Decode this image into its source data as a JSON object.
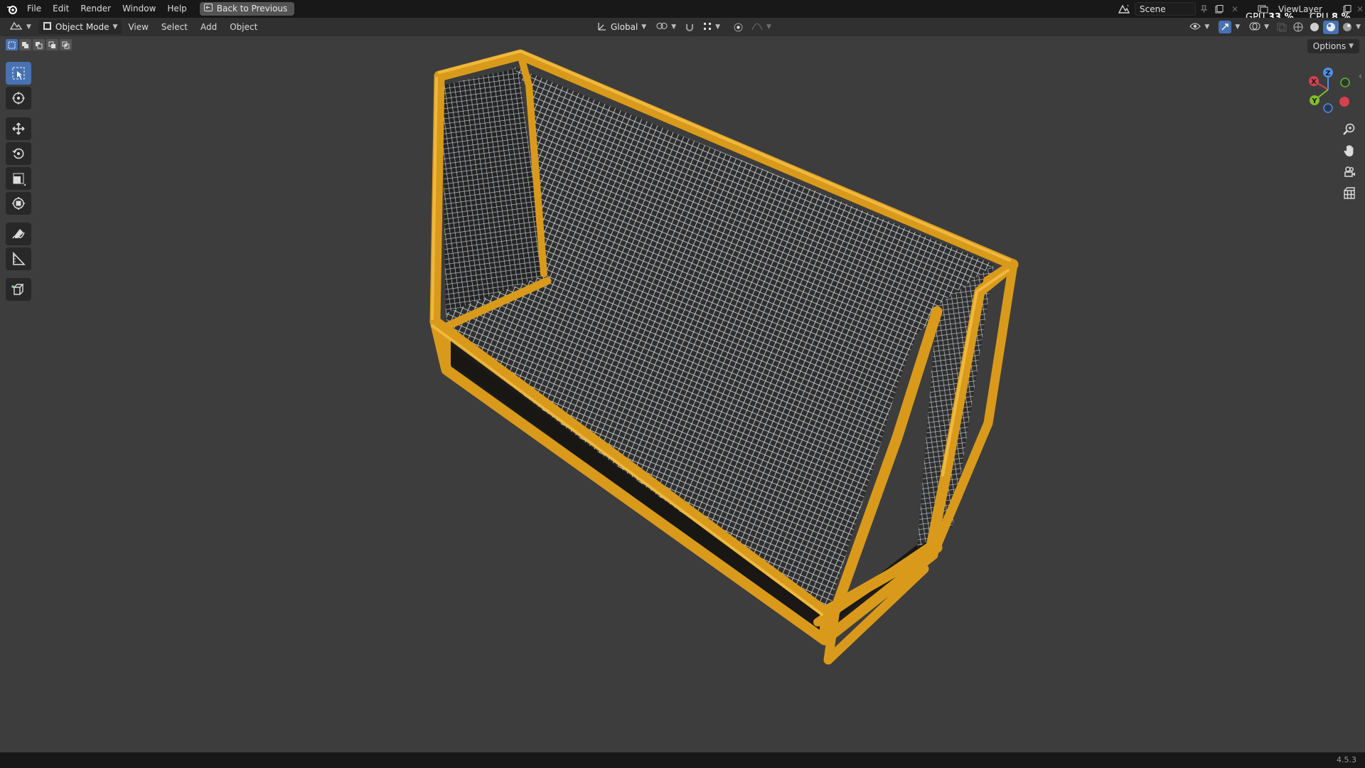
{
  "menu": {
    "items": [
      "File",
      "Edit",
      "Render",
      "Window",
      "Help"
    ],
    "back_button": "Back to Previous"
  },
  "top_right": {
    "scene": "Scene",
    "view_layer": "ViewLayer",
    "gpu_label": "GPU",
    "gpu_value": "33 %",
    "cpu_label": "CPU",
    "cpu_value": "8 %"
  },
  "header": {
    "mode": "Object Mode",
    "menus": [
      "View",
      "Select",
      "Add",
      "Object"
    ],
    "transform_orientation": "Global"
  },
  "viewport": {
    "options_label": "Options",
    "gizmo": {
      "x": "X",
      "y": "Y",
      "z": "Z"
    },
    "tools": [
      "select-box-icon",
      "cursor-icon",
      "move-icon",
      "rotate-icon",
      "scale-icon",
      "transform-icon",
      "annotate-icon",
      "measure-icon",
      "add-cube-icon"
    ]
  },
  "status": {
    "version": "4.5.3"
  },
  "colors": {
    "accent": "#4772b3",
    "frame": "#e3a423",
    "net": "#d8dde3",
    "background": "#3d3d3d"
  }
}
